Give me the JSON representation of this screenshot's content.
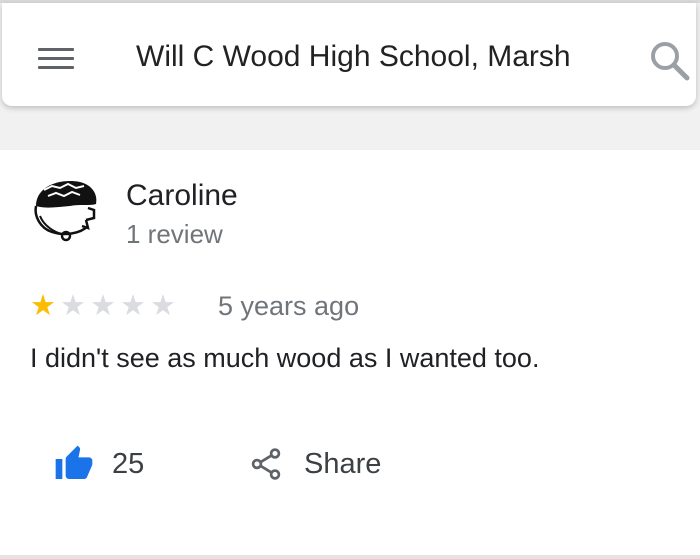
{
  "search": {
    "query": "Will C Wood High School, Marsh"
  },
  "review": {
    "author_name": "Caroline",
    "author_meta": "1 review",
    "rating": 1,
    "max_rating": 5,
    "time_ago": "5 years ago",
    "text": "I didn't see as much wood as I wanted too."
  },
  "actions": {
    "like_count": "25",
    "share_label": "Share"
  },
  "icons": {
    "menu": "menu-icon",
    "search": "search-icon",
    "like": "thumb-up-icon",
    "share": "share-icon",
    "star": "star-icon"
  },
  "colors": {
    "star_filled": "#fbbc04",
    "star_empty": "#dadce0",
    "like_blue": "#1a73e8",
    "secondary_text": "#70757a"
  }
}
